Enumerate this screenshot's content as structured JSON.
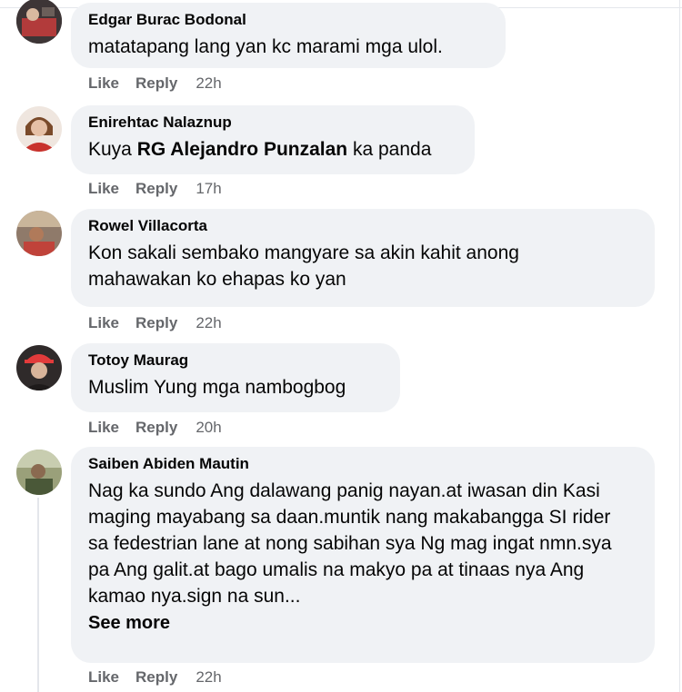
{
  "comments": [
    {
      "author": "Edgar Burac Bodonal",
      "text": "matatapang lang yan kc marami mga ulol.",
      "actions": {
        "like": "Like",
        "reply": "Reply",
        "time": "22h"
      },
      "avatar_colors": [
        "#5a4a4a",
        "#c83a3a"
      ]
    },
    {
      "author": "Enirehtac Nalaznup",
      "text_before": "Kuya ",
      "mention": "RG Alejandro Punzalan",
      "text_after": " ka panda",
      "actions": {
        "like": "Like",
        "reply": "Reply",
        "time": "17h"
      },
      "avatar_colors": [
        "#e8c4b0",
        "#c0392b"
      ]
    },
    {
      "author": "Rowel Villacorta",
      "text": "Kon sakali sembako mangyare sa akin kahit anong mahawakan ko ehapas ko yan",
      "actions": {
        "like": "Like",
        "reply": "Reply",
        "time": "22h"
      },
      "avatar_colors": [
        "#8a6a5a",
        "#d05040"
      ]
    },
    {
      "author": "Totoy Maurag",
      "text": "Muslim Yung mga nambogbog",
      "actions": {
        "like": "Like",
        "reply": "Reply",
        "time": "20h"
      },
      "avatar_colors": [
        "#d94040",
        "#3a3030"
      ]
    },
    {
      "author": "Saiben Abiden Mautin",
      "text": "Nag ka sundo Ang dalawang panig nayan.at iwasan din Kasi maging mayabang sa daan.muntik nang makabangga SI rider sa fedestrian lane at nong sabihan sya Ng mag ingat nmn.sya pa Ang galit.at bago umalis na makyo pa at tinaas nya Ang kamao nya.sign na sun...",
      "see_more": "See more",
      "actions": {
        "like": "Like",
        "reply": "Reply",
        "time": "22h"
      },
      "avatar_colors": [
        "#7a8a60",
        "#4a5a40"
      ]
    }
  ]
}
